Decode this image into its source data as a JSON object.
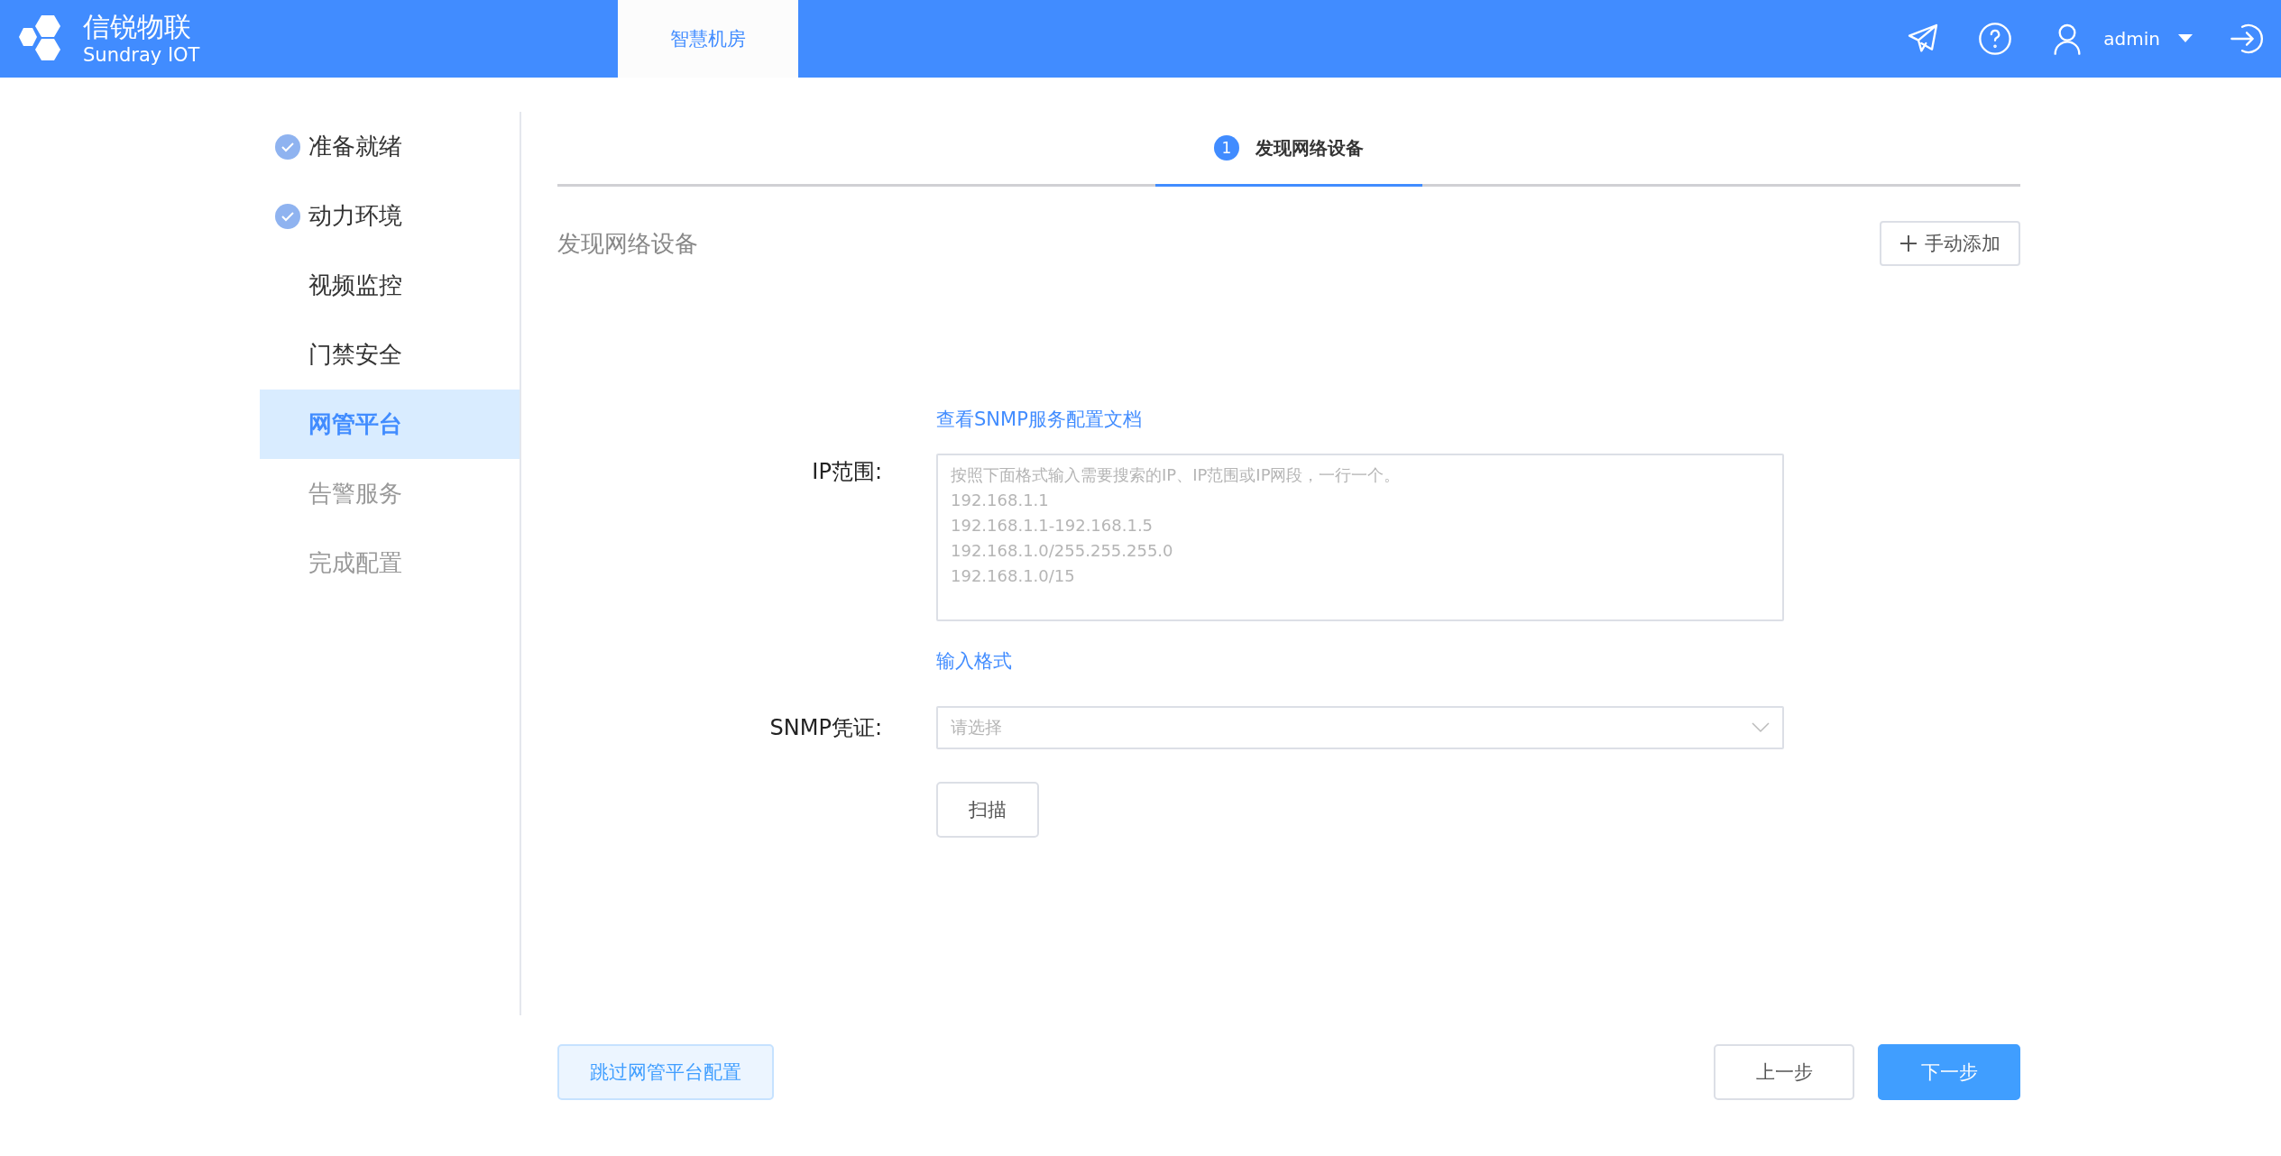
{
  "header": {
    "brand_name": "信锐物联",
    "brand_sub": "Sundray IOT",
    "tabs": [
      {
        "label": "智慧机房",
        "selected": true
      }
    ],
    "user": "admin"
  },
  "sidebar": {
    "items": [
      {
        "label": "准备就绪",
        "checked": true,
        "selected": false,
        "disabled": false
      },
      {
        "label": "动力环境",
        "checked": true,
        "selected": false,
        "disabled": false
      },
      {
        "label": "视频监控",
        "checked": false,
        "selected": false,
        "disabled": false
      },
      {
        "label": "门禁安全",
        "checked": false,
        "selected": false,
        "disabled": false
      },
      {
        "label": "网管平台",
        "checked": false,
        "selected": true,
        "disabled": false
      },
      {
        "label": "告警服务",
        "checked": false,
        "selected": false,
        "disabled": true
      },
      {
        "label": "完成配置",
        "checked": false,
        "selected": false,
        "disabled": true
      }
    ]
  },
  "steps": [
    {
      "number": "1",
      "label": "发现网络设备",
      "selected": true
    }
  ],
  "section": {
    "title": "发现网络设备",
    "add_button": "手动添加"
  },
  "form": {
    "doc_link": "查看SNMP服务配置文档",
    "ip_label": "IP范围:",
    "ip_placeholder": "按照下面格式输入需要搜索的IP、IP范围或IP网段，一行一个。\n192.168.1.1\n192.168.1.1-192.168.1.5\n192.168.1.0/255.255.255.0\n192.168.1.0/15",
    "format_link": "输入格式",
    "snmp_label": "SNMP凭证:",
    "snmp_placeholder": "请选择",
    "scan_button": "扫描"
  },
  "footer": {
    "skip_button": "跳过网管平台配置",
    "prev_button": "上一步",
    "next_button": "下一步"
  }
}
